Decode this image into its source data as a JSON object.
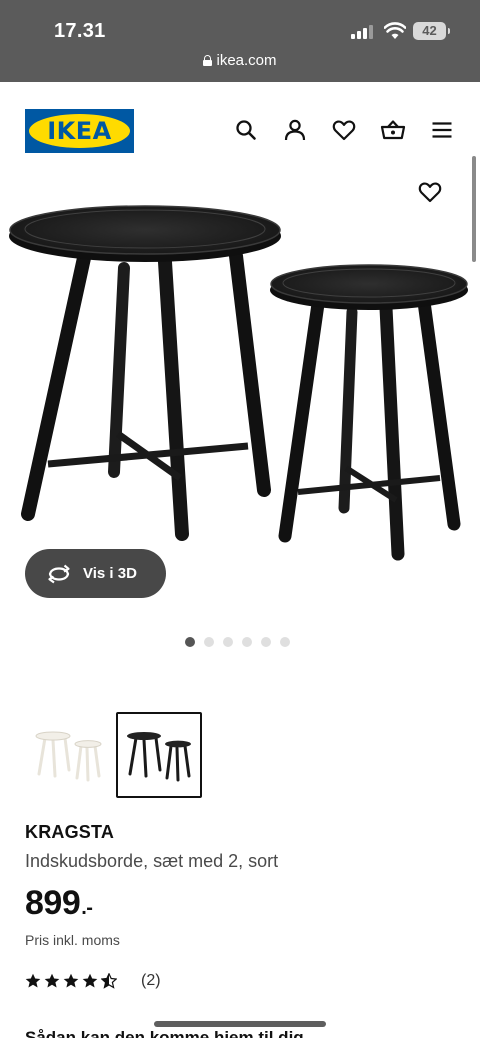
{
  "status_bar": {
    "time": "17.31",
    "battery": "42"
  },
  "browser": {
    "url": "ikea.com"
  },
  "header": {
    "logo_text": "IKEA",
    "icons": [
      "search-icon",
      "account-icon",
      "heart-icon",
      "basket-icon",
      "menu-icon"
    ]
  },
  "gallery": {
    "view_3d_label": "Vis i 3D",
    "slide_count": 6,
    "active_slide": 1,
    "thumbnails": [
      {
        "name": "white",
        "selected": false
      },
      {
        "name": "black",
        "selected": true
      }
    ]
  },
  "product": {
    "name": "KRAGSTA",
    "description": "Indskudsborde, sæt med 2, sort",
    "price": "899",
    "price_suffix": ".-",
    "vat_note": "Pris inkl. moms",
    "rating": 4.5,
    "review_count": "(2)"
  },
  "delivery": {
    "heading": "Sådan kan den komme hjem til dig"
  },
  "colors": {
    "ikea_blue": "#0058a3",
    "ikea_yellow": "#ffdb00",
    "topbar": "#5b5b5b"
  }
}
